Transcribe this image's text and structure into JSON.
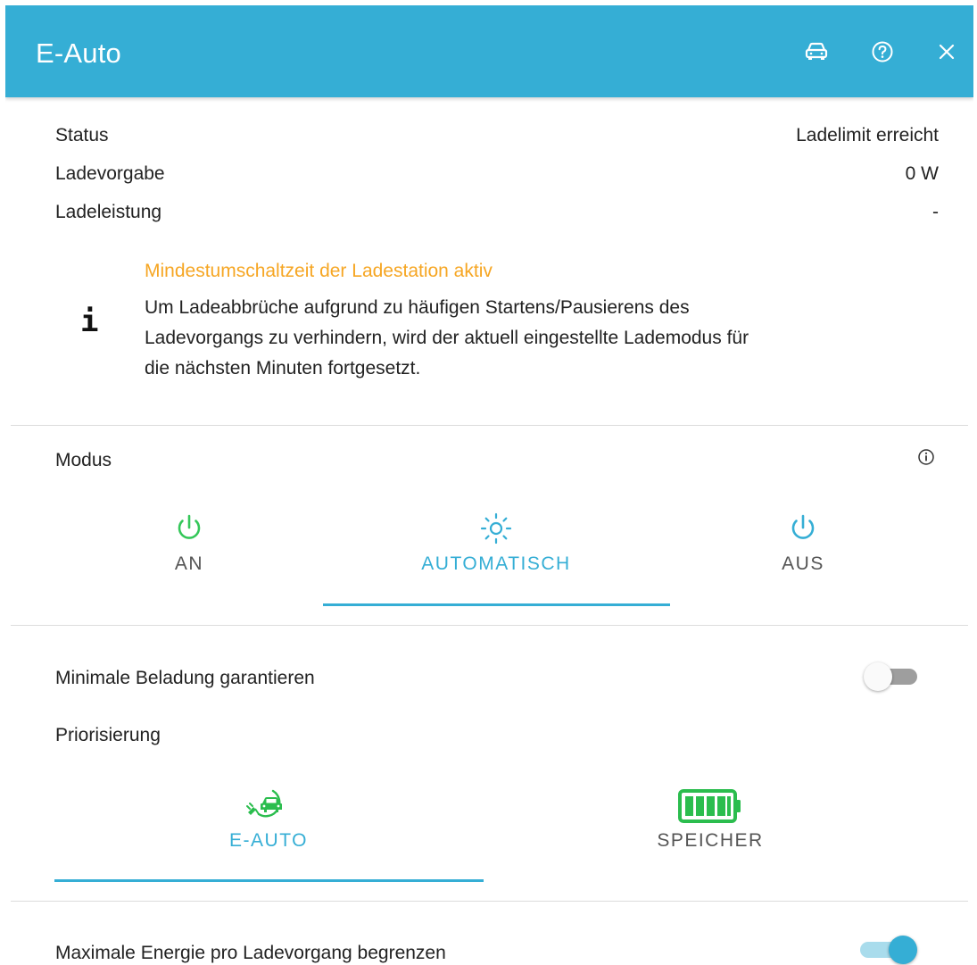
{
  "header": {
    "title": "E-Auto",
    "icons": [
      "car-icon",
      "help-icon",
      "close-icon"
    ]
  },
  "status": [
    {
      "label": "Status",
      "value": "Ladelimit erreicht"
    },
    {
      "label": "Ladevorgabe",
      "value": "0 W"
    },
    {
      "label": "Ladeleistung",
      "value": "-"
    }
  ],
  "info": {
    "icon": "info-letter-icon",
    "icon_glyph": "i",
    "title": "Mindestumschaltzeit der Ladestation aktiv",
    "text_line1": "Um Ladeabbrüche aufgrund zu häufigen Startens/Pausierens des",
    "text_line2": "Ladevorgangs zu verhindern, wird der aktuell eingestellte Lademodus für",
    "text_line3": "die nächsten Minuten fortgesetzt."
  },
  "modus": {
    "label": "Modus",
    "info_icon": "info-circle-icon",
    "tabs": [
      {
        "label": "AN",
        "icon": "power-icon",
        "icon_color": "#34c759",
        "selected": false
      },
      {
        "label": "AUTOMATISCH",
        "icon": "sun-icon",
        "icon_color": "#35aed5",
        "selected": true
      },
      {
        "label": "AUS",
        "icon": "power-icon",
        "icon_color": "#35aed5",
        "selected": false
      }
    ]
  },
  "min_charge": {
    "label": "Minimale Beladung garantieren",
    "enabled": false
  },
  "priority": {
    "label": "Priorisierung",
    "tabs": [
      {
        "label": "E-AUTO",
        "icon": "ev-charging-car-icon",
        "icon_color": "#2bbd4e",
        "selected": true
      },
      {
        "label": "SPEICHER",
        "icon": "battery-full-icon",
        "icon_color": "#2bbd4e",
        "selected": false
      }
    ]
  },
  "max_energy": {
    "label": "Maximale Energie pro Ladevorgang begrenzen",
    "enabled": true
  },
  "colors": {
    "accent": "#35aed5",
    "warning": "#f6a623",
    "green": "#34c759",
    "tab_inactive": "#555555"
  }
}
